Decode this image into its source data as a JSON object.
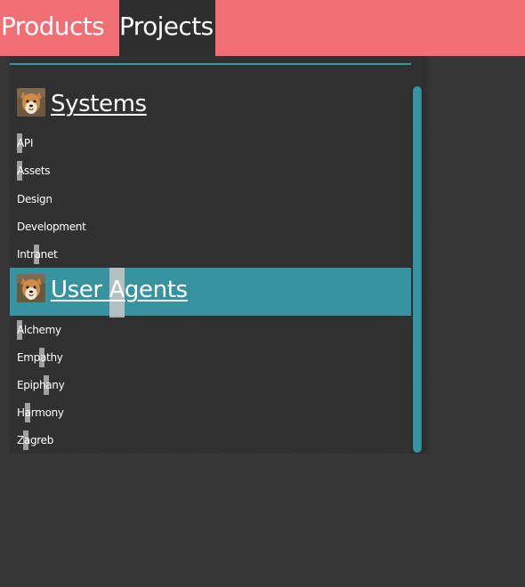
{
  "nav": {
    "tabs": [
      {
        "label": "Products"
      },
      {
        "label": "Projects"
      }
    ]
  },
  "colors": {
    "nav_background": "#f06e74",
    "active_tab": "#2e2e2e",
    "accent": "#36939f",
    "page_background": "#363636"
  },
  "groups": [
    {
      "title": "Systems",
      "avatar_icon": "shiba-dog-avatar",
      "items": [
        "API",
        "Assets",
        "Design",
        "Development",
        "Intranet"
      ]
    },
    {
      "title": "User Agents",
      "avatar_icon": "shiba-dog-avatar",
      "items": [
        "Alchemy",
        "Empathy",
        "Epiphany",
        "Harmony",
        "Zagreb"
      ]
    }
  ]
}
